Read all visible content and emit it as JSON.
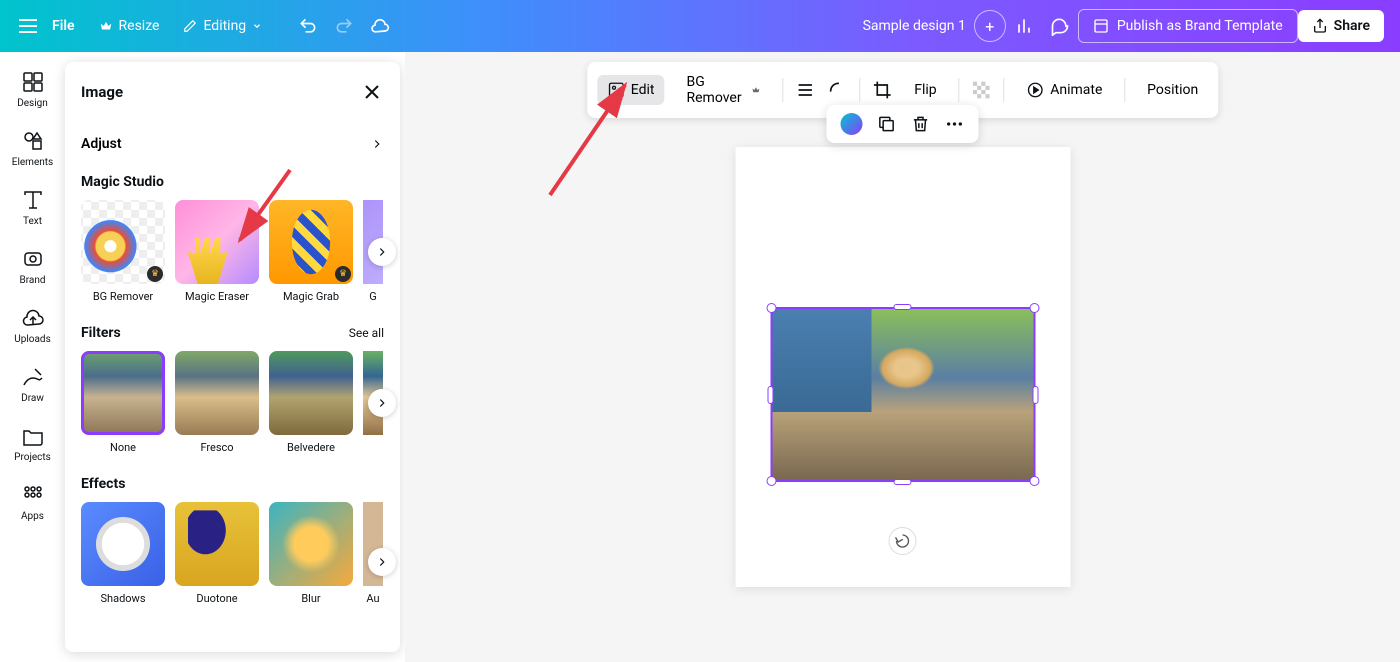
{
  "header": {
    "file": "File",
    "resize": "Resize",
    "editing": "Editing",
    "design_title": "Sample design 1",
    "publish": "Publish as Brand Template",
    "share": "Share"
  },
  "sidebar": {
    "items": [
      {
        "label": "Design",
        "icon": "design-icon"
      },
      {
        "label": "Elements",
        "icon": "elements-icon"
      },
      {
        "label": "Text",
        "icon": "text-icon"
      },
      {
        "label": "Brand",
        "icon": "brand-icon"
      },
      {
        "label": "Uploads",
        "icon": "uploads-icon"
      },
      {
        "label": "Draw",
        "icon": "draw-icon"
      },
      {
        "label": "Projects",
        "icon": "projects-icon"
      },
      {
        "label": "Apps",
        "icon": "apps-icon"
      }
    ]
  },
  "panel": {
    "title": "Image",
    "adjust": "Adjust",
    "magic_studio": {
      "title": "Magic Studio",
      "tiles": [
        {
          "label": "BG Remover",
          "premium": true
        },
        {
          "label": "Magic Eraser",
          "premium": false
        },
        {
          "label": "Magic Grab",
          "premium": true
        },
        {
          "label": "G",
          "premium": false
        }
      ]
    },
    "filters": {
      "title": "Filters",
      "see_all": "See all",
      "tiles": [
        {
          "label": "None",
          "selected": true
        },
        {
          "label": "Fresco",
          "selected": false
        },
        {
          "label": "Belvedere",
          "selected": false
        }
      ]
    },
    "effects": {
      "title": "Effects",
      "tiles": [
        {
          "label": "Shadows"
        },
        {
          "label": "Duotone"
        },
        {
          "label": "Blur"
        },
        {
          "label": "Au"
        }
      ]
    }
  },
  "toolbar": {
    "edit": "Edit",
    "bg_remover": "BG Remover",
    "flip": "Flip",
    "animate": "Animate",
    "position": "Position"
  }
}
